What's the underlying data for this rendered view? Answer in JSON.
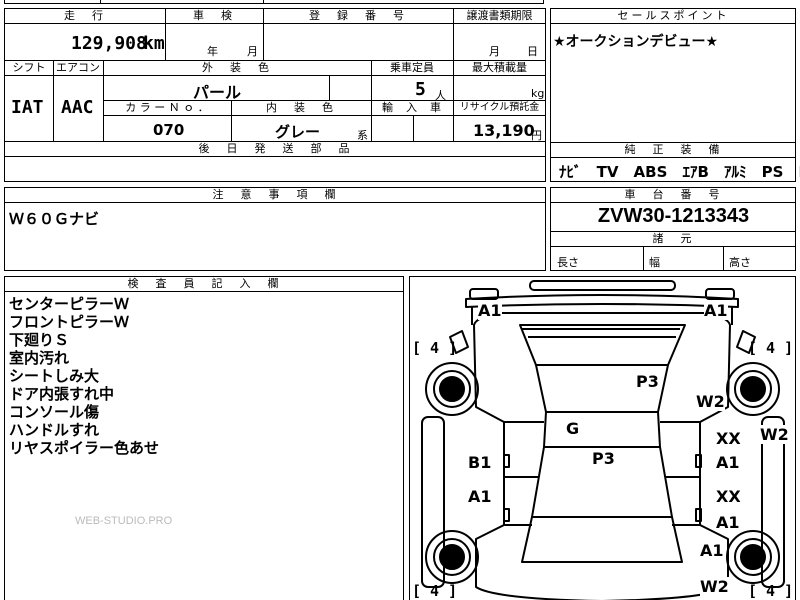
{
  "header": {
    "mileage_label": "走　行",
    "inspection_label": "車　検",
    "registration_label": "登　録　番　号",
    "transfer_docs_label": "譲渡書類期限",
    "selling_points_label": "セールスポイント"
  },
  "row1": {
    "mileage_value": "129,908",
    "mileage_unit": "km",
    "inspection_year": "年",
    "inspection_month": "月",
    "transfer_month": "月",
    "transfer_day": "日"
  },
  "sales_point": "★オークションデビュー★",
  "specs": {
    "shift_label": "シフト",
    "ac_label": "エアコン",
    "exterior_color_label": "外　装　色",
    "capacity_label": "乗車定員",
    "max_load_label": "最大積載量",
    "shift_value": "IAT",
    "ac_value": "AAC",
    "exterior_color_value": "パール",
    "capacity_value": "5",
    "capacity_unit": "人",
    "max_load_unit": "kg",
    "color_no_label": "カ ラ ー Ｎ ｏ ．",
    "interior_color_label": "内　装　色",
    "import_label": "輸　入　車",
    "recycle_label": "リサイクル預託金",
    "color_no_value": "070",
    "interior_color_value": "グレー",
    "interior_color_suffix": "系",
    "recycle_value": "13,190",
    "recycle_unit": "円"
  },
  "parts": {
    "label": "後　日　発　送　部　品"
  },
  "equipment": {
    "label": "純　正　装　備",
    "items": [
      "ﾅﾋﾞ",
      "TV",
      "ABS",
      "ｴｱB",
      "ｱﾙﾐ",
      "PS",
      "PW"
    ]
  },
  "caution": {
    "label": "注　意　事　項　欄",
    "value": "Ｗ６０Ｇナビ"
  },
  "chassis": {
    "label": "車　台　番　号",
    "value": "ZVW30-1213343",
    "dims_label": "諸　元",
    "length_label": "長さ",
    "width_label": "幅",
    "height_label": "高さ"
  },
  "inspector": {
    "label": "検　査　員　記　入　欄",
    "notes": [
      "センターピラーＷ",
      "フロントピラーＷ",
      "下廻りＳ",
      "室内汚れ",
      "シートしみ大",
      "ドア内張すれ中",
      "コンソール傷",
      "ハンドルすれ",
      "リヤスポイラー色あせ"
    ],
    "watermark": "WEB-STUDIO.PRO"
  },
  "diagram": {
    "tire_tl": "[ 4 ]",
    "tire_tr": "[ 4 ]",
    "tire_bl": "[ 4 ]",
    "tire_br": "[ 4 ]",
    "marks": {
      "a1_front_left": "A1",
      "a1_front_right": "A1",
      "p3_hood": "P3",
      "w2_front_right": "W2",
      "w2_right_edge": "W2",
      "g_glass": "G",
      "p3_roof": "P3",
      "b1_left": "B1",
      "a1_left_rear": "A1",
      "xx_right_front": "XX",
      "a1_right_front_door": "A1",
      "xx_right_rear": "XX",
      "a1_right_rear_door": "A1",
      "a1_rear_right": "A1",
      "w2_rear_right": "W2"
    }
  }
}
